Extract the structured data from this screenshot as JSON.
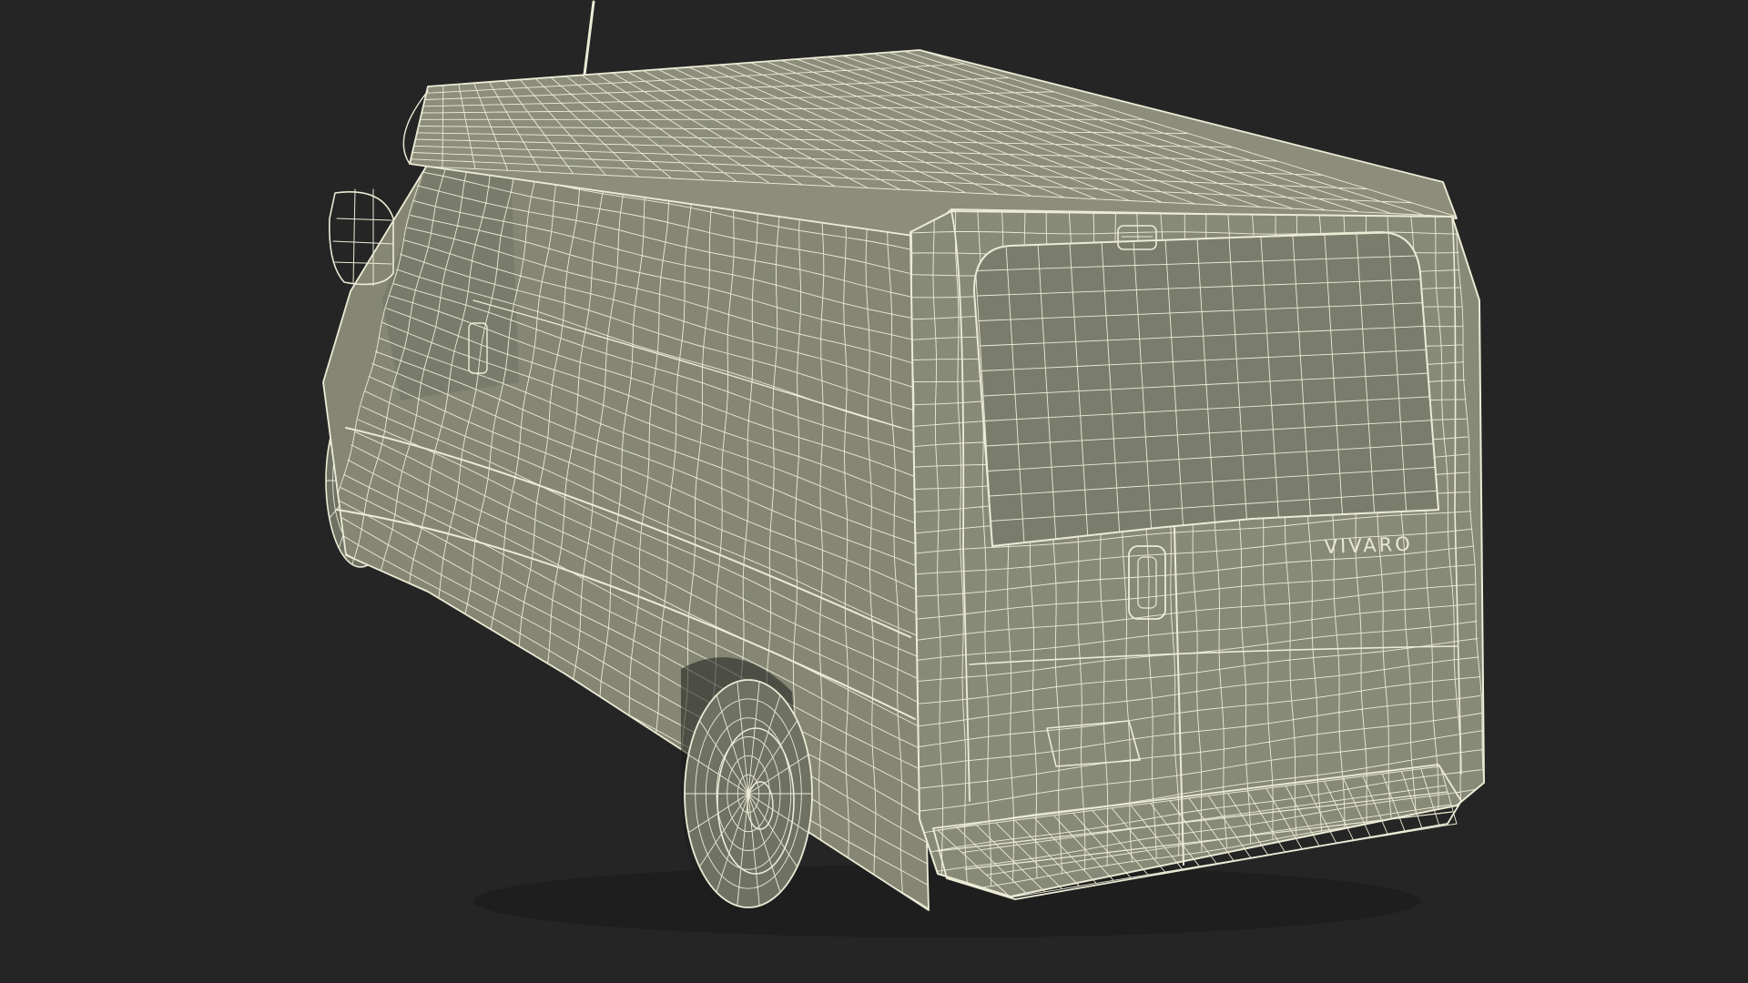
{
  "scene": {
    "subject": "van-wireframe-render",
    "emblem_text": "VIVARO"
  },
  "colors": {
    "background": "#252525",
    "body_fill": "#888a78",
    "panel_fill": "#7e806f",
    "panel_fill_dark": "#737565",
    "tire_fill": "#6f7163",
    "wire": "#ecebd6",
    "shadow": "#1b1b1b"
  }
}
